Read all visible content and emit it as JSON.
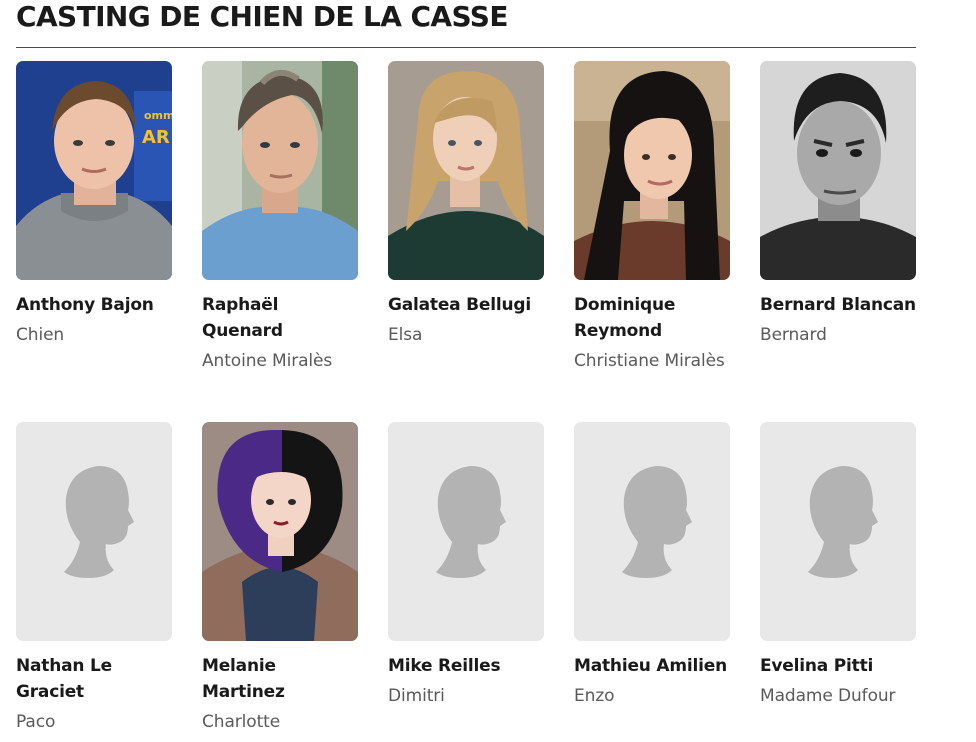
{
  "section": {
    "title": "CASTING DE CHIEN DE LA CASSE"
  },
  "cast": [
    {
      "name": "Anthony Bajon",
      "role": "Chien",
      "photo": "portrait",
      "icon": "actor-photo"
    },
    {
      "name": "Raphaël Quenard",
      "role": "Antoine Miralès",
      "photo": "portrait",
      "icon": "actor-photo"
    },
    {
      "name": "Galatea Bellugi",
      "role": "Elsa",
      "photo": "portrait",
      "icon": "actor-photo"
    },
    {
      "name": "Dominique Reymond",
      "role": "Christiane Miralès",
      "photo": "portrait",
      "icon": "actor-photo"
    },
    {
      "name": "Bernard Blancan",
      "role": "Bernard",
      "photo": "portrait",
      "icon": "actor-photo"
    },
    {
      "name": "Nathan Le Graciet",
      "role": "Paco",
      "photo": "placeholder",
      "icon": "person-silhouette-icon"
    },
    {
      "name": "Melanie Martinez",
      "role": "Charlotte",
      "photo": "portrait",
      "icon": "actor-photo"
    },
    {
      "name": "Mike Reilles",
      "role": "Dimitri",
      "photo": "placeholder",
      "icon": "person-silhouette-icon"
    },
    {
      "name": "Mathieu Amilien",
      "role": "Enzo",
      "photo": "placeholder",
      "icon": "person-silhouette-icon"
    },
    {
      "name": "Evelina Pitti",
      "role": "Madame Dufour",
      "photo": "placeholder",
      "icon": "person-silhouette-icon"
    }
  ],
  "colors": {
    "title_text": "#1a1a1a",
    "rule": "#4a4a4a",
    "role_text": "#5a5a5a",
    "placeholder_bg": "#e8e8e8",
    "placeholder_silhouette": "#b3b3b3"
  }
}
